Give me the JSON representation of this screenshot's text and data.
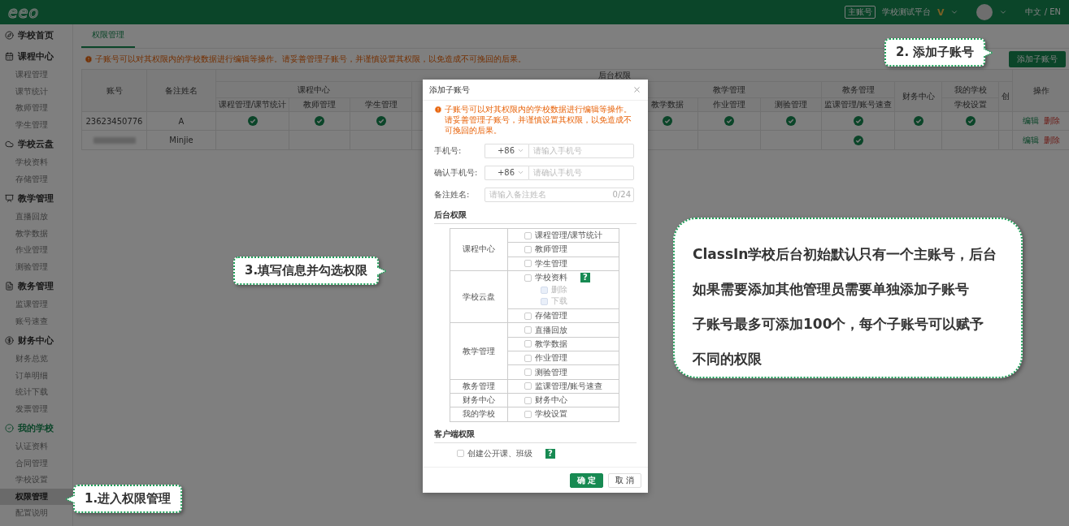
{
  "topbar": {
    "logo": "eeo",
    "account_badge": "主账号",
    "platform": "学校测试平台",
    "vip_mark": "V",
    "language": "中文 / EN"
  },
  "sidebar": {
    "sections": [
      {
        "label": "学校首页",
        "selected": false
      },
      {
        "label": "课程中心",
        "selected": false,
        "children": [
          {
            "label": "课程管理",
            "selected": false
          },
          {
            "label": "课节统计",
            "selected": false
          },
          {
            "label": "教师管理",
            "selected": false
          },
          {
            "label": "学生管理",
            "selected": false
          }
        ]
      },
      {
        "label": "学校云盘",
        "selected": false,
        "children": [
          {
            "label": "学校资料",
            "selected": false
          },
          {
            "label": "存储管理",
            "selected": false
          }
        ]
      },
      {
        "label": "教学管理",
        "selected": false,
        "children": [
          {
            "label": "直播回放",
            "selected": false
          },
          {
            "label": "教学数据",
            "selected": false
          },
          {
            "label": "作业管理",
            "selected": false
          },
          {
            "label": "测验管理",
            "selected": false
          }
        ]
      },
      {
        "label": "教务管理",
        "selected": false,
        "children": [
          {
            "label": "监课管理",
            "selected": false
          },
          {
            "label": "账号速查",
            "selected": false
          }
        ]
      },
      {
        "label": "财务中心",
        "selected": false,
        "children": [
          {
            "label": "财务总览",
            "selected": false
          },
          {
            "label": "订单明细",
            "selected": false
          },
          {
            "label": "统计下载",
            "selected": false
          },
          {
            "label": "发票管理",
            "selected": false
          }
        ]
      },
      {
        "label": "我的学校",
        "selected": true,
        "children": [
          {
            "label": "认证资料",
            "selected": false
          },
          {
            "label": "合同管理",
            "selected": false
          },
          {
            "label": "学校设置",
            "selected": false
          },
          {
            "label": "权限管理",
            "selected": true
          },
          {
            "label": "配置说明",
            "selected": false
          }
        ]
      }
    ]
  },
  "tabs": [
    {
      "label": "权限管理",
      "selected": true
    }
  ],
  "warning": "子账号可以对其权限内的学校数据进行编辑等操作。请妥善管理子账号，并谨慎设置其权限，以免造成不可挽回的后果。",
  "add_button": "添加子账号",
  "table": {
    "account_header": "账号",
    "name_header": "备注姓名",
    "group_header": "后台权限",
    "groups": [
      {
        "label": "课程中心",
        "kind": "group",
        "columns": [
          "课程管理/课节统计",
          "教师管理",
          "学生管理"
        ]
      },
      {
        "label": "教学管理",
        "kind": "group",
        "columns": [
          "教学数据",
          "作业管理",
          "测验管理"
        ]
      },
      {
        "label": "教务管理",
        "kind": "group",
        "columns": [
          "监课管理/账号速查"
        ]
      },
      {
        "label": "财务中心",
        "kind": "single"
      },
      {
        "label": "我的学校",
        "kind": "group",
        "columns": [
          "学校设置"
        ]
      }
    ],
    "extra_column": "创",
    "actions_header": "操作",
    "rows": [
      {
        "account": "23623450776",
        "name": "A",
        "checks": [
          true,
          true,
          true,
          true,
          true,
          true,
          true,
          true,
          true
        ],
        "actions": [
          "编辑",
          "删除"
        ]
      },
      {
        "name": "Minjie",
        "checks": [
          false,
          false,
          false,
          false,
          false,
          false,
          true,
          false,
          false
        ],
        "actions": [
          "编辑",
          "删除"
        ]
      }
    ]
  },
  "modal": {
    "title": "添加子账号",
    "warning": "子账号可以对其权限内的学校数据进行编辑等操作。请妥善管理子账号，并谨慎设置其权限，以免造成不可挽回的后果。",
    "fields": [
      {
        "label": "手机号:",
        "kind": "phone",
        "code": "+86",
        "placeholder": "请输入手机号"
      },
      {
        "label": "确认手机号:",
        "kind": "phone",
        "code": "+86",
        "placeholder": "请确认手机号"
      },
      {
        "label": "备注姓名:",
        "kind": "text",
        "placeholder": "请输入备注姓名",
        "counter": "0/24"
      }
    ],
    "backend_title": "后台权限",
    "permission_groups": [
      {
        "label": "课程中心",
        "items": [
          {
            "label": "课程管理/课节统计",
            "checked": false
          },
          {
            "label": "教师管理",
            "checked": false
          },
          {
            "label": "学生管理",
            "checked": false
          }
        ]
      },
      {
        "label": "学校云盘",
        "items": [
          {
            "label": "学校资料",
            "checked": false,
            "help": "?",
            "children": [
              {
                "label": "删除",
                "checked": false,
                "disabled": true
              },
              {
                "label": "下载",
                "checked": false,
                "disabled": true
              }
            ]
          },
          {
            "label": "存储管理",
            "checked": false
          }
        ]
      },
      {
        "label": "教学管理",
        "items": [
          {
            "label": "直播回放",
            "checked": false
          },
          {
            "label": "教学数据",
            "checked": false
          },
          {
            "label": "作业管理",
            "checked": false
          },
          {
            "label": "测验管理",
            "checked": false
          }
        ]
      },
      {
        "label": "教务管理",
        "items": [
          {
            "label": "监课管理/账号速查",
            "checked": false
          }
        ]
      },
      {
        "label": "财务中心",
        "items": [
          {
            "label": "财务中心",
            "checked": false
          }
        ]
      },
      {
        "label": "我的学校",
        "items": [
          {
            "label": "学校设置",
            "checked": false
          }
        ]
      }
    ],
    "client_title": "客户端权限",
    "client_items": [
      {
        "label": "创建公开课、班级",
        "checked": false,
        "help": "?"
      }
    ],
    "buttons": [
      {
        "label": "确 定",
        "kind": "primary"
      },
      {
        "label": "取 消",
        "kind": "default"
      }
    ]
  },
  "callouts": [
    {
      "text": "2. 添加子账号"
    },
    {
      "text": "3.填写信息并勾选权限"
    },
    {
      "text": "1.进入权限管理"
    }
  ],
  "note": {
    "paragraphs": [
      "ClassIn学校后台初始默认只有一个主账号，后台如果需要添加其他管理员需要单独添加子账号",
      "子账号最多可添加100个，每个子账号可以赋予不同的权限"
    ]
  }
}
